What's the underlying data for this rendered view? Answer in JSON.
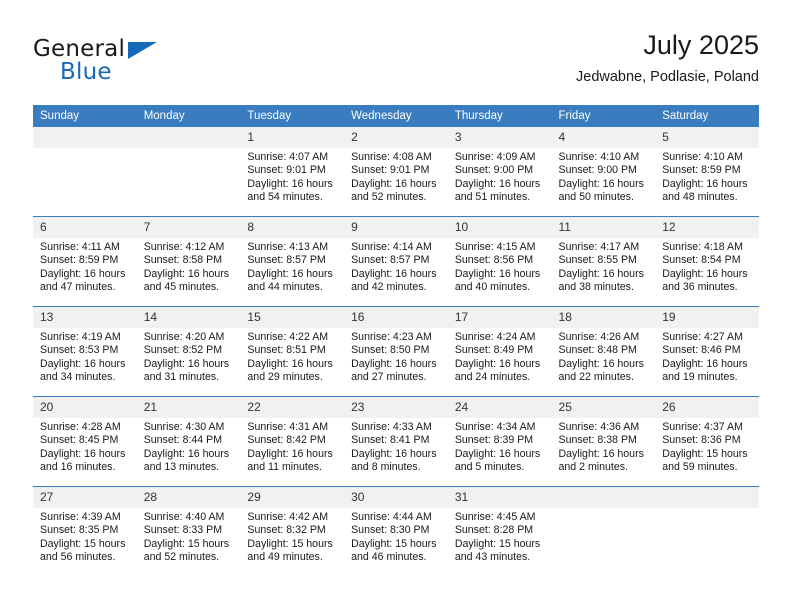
{
  "brand": {
    "line1": "General",
    "line2": "Blue",
    "triangle_color": "#1668b8"
  },
  "header": {
    "title": "July 2025",
    "subtitle": "Jedwabne, Podlasie, Poland"
  },
  "theme": {
    "header_bg": "#3a7cc0",
    "header_text": "#ffffff",
    "daynum_bg": "#f1f1f1",
    "grid_line": "#3a7cc0",
    "text": "#1a1a1a"
  },
  "weekdays": [
    "Sunday",
    "Monday",
    "Tuesday",
    "Wednesday",
    "Thursday",
    "Friday",
    "Saturday"
  ],
  "weeks": [
    [
      {
        "day": "",
        "sunrise": "",
        "sunset": "",
        "daylight_line1": "",
        "daylight_line2": ""
      },
      {
        "day": "",
        "sunrise": "",
        "sunset": "",
        "daylight_line1": "",
        "daylight_line2": ""
      },
      {
        "day": "1",
        "sunrise": "Sunrise: 4:07 AM",
        "sunset": "Sunset: 9:01 PM",
        "daylight_line1": "Daylight: 16 hours",
        "daylight_line2": "and 54 minutes."
      },
      {
        "day": "2",
        "sunrise": "Sunrise: 4:08 AM",
        "sunset": "Sunset: 9:01 PM",
        "daylight_line1": "Daylight: 16 hours",
        "daylight_line2": "and 52 minutes."
      },
      {
        "day": "3",
        "sunrise": "Sunrise: 4:09 AM",
        "sunset": "Sunset: 9:00 PM",
        "daylight_line1": "Daylight: 16 hours",
        "daylight_line2": "and 51 minutes."
      },
      {
        "day": "4",
        "sunrise": "Sunrise: 4:10 AM",
        "sunset": "Sunset: 9:00 PM",
        "daylight_line1": "Daylight: 16 hours",
        "daylight_line2": "and 50 minutes."
      },
      {
        "day": "5",
        "sunrise": "Sunrise: 4:10 AM",
        "sunset": "Sunset: 8:59 PM",
        "daylight_line1": "Daylight: 16 hours",
        "daylight_line2": "and 48 minutes."
      }
    ],
    [
      {
        "day": "6",
        "sunrise": "Sunrise: 4:11 AM",
        "sunset": "Sunset: 8:59 PM",
        "daylight_line1": "Daylight: 16 hours",
        "daylight_line2": "and 47 minutes."
      },
      {
        "day": "7",
        "sunrise": "Sunrise: 4:12 AM",
        "sunset": "Sunset: 8:58 PM",
        "daylight_line1": "Daylight: 16 hours",
        "daylight_line2": "and 45 minutes."
      },
      {
        "day": "8",
        "sunrise": "Sunrise: 4:13 AM",
        "sunset": "Sunset: 8:57 PM",
        "daylight_line1": "Daylight: 16 hours",
        "daylight_line2": "and 44 minutes."
      },
      {
        "day": "9",
        "sunrise": "Sunrise: 4:14 AM",
        "sunset": "Sunset: 8:57 PM",
        "daylight_line1": "Daylight: 16 hours",
        "daylight_line2": "and 42 minutes."
      },
      {
        "day": "10",
        "sunrise": "Sunrise: 4:15 AM",
        "sunset": "Sunset: 8:56 PM",
        "daylight_line1": "Daylight: 16 hours",
        "daylight_line2": "and 40 minutes."
      },
      {
        "day": "11",
        "sunrise": "Sunrise: 4:17 AM",
        "sunset": "Sunset: 8:55 PM",
        "daylight_line1": "Daylight: 16 hours",
        "daylight_line2": "and 38 minutes."
      },
      {
        "day": "12",
        "sunrise": "Sunrise: 4:18 AM",
        "sunset": "Sunset: 8:54 PM",
        "daylight_line1": "Daylight: 16 hours",
        "daylight_line2": "and 36 minutes."
      }
    ],
    [
      {
        "day": "13",
        "sunrise": "Sunrise: 4:19 AM",
        "sunset": "Sunset: 8:53 PM",
        "daylight_line1": "Daylight: 16 hours",
        "daylight_line2": "and 34 minutes."
      },
      {
        "day": "14",
        "sunrise": "Sunrise: 4:20 AM",
        "sunset": "Sunset: 8:52 PM",
        "daylight_line1": "Daylight: 16 hours",
        "daylight_line2": "and 31 minutes."
      },
      {
        "day": "15",
        "sunrise": "Sunrise: 4:22 AM",
        "sunset": "Sunset: 8:51 PM",
        "daylight_line1": "Daylight: 16 hours",
        "daylight_line2": "and 29 minutes."
      },
      {
        "day": "16",
        "sunrise": "Sunrise: 4:23 AM",
        "sunset": "Sunset: 8:50 PM",
        "daylight_line1": "Daylight: 16 hours",
        "daylight_line2": "and 27 minutes."
      },
      {
        "day": "17",
        "sunrise": "Sunrise: 4:24 AM",
        "sunset": "Sunset: 8:49 PM",
        "daylight_line1": "Daylight: 16 hours",
        "daylight_line2": "and 24 minutes."
      },
      {
        "day": "18",
        "sunrise": "Sunrise: 4:26 AM",
        "sunset": "Sunset: 8:48 PM",
        "daylight_line1": "Daylight: 16 hours",
        "daylight_line2": "and 22 minutes."
      },
      {
        "day": "19",
        "sunrise": "Sunrise: 4:27 AM",
        "sunset": "Sunset: 8:46 PM",
        "daylight_line1": "Daylight: 16 hours",
        "daylight_line2": "and 19 minutes."
      }
    ],
    [
      {
        "day": "20",
        "sunrise": "Sunrise: 4:28 AM",
        "sunset": "Sunset: 8:45 PM",
        "daylight_line1": "Daylight: 16 hours",
        "daylight_line2": "and 16 minutes."
      },
      {
        "day": "21",
        "sunrise": "Sunrise: 4:30 AM",
        "sunset": "Sunset: 8:44 PM",
        "daylight_line1": "Daylight: 16 hours",
        "daylight_line2": "and 13 minutes."
      },
      {
        "day": "22",
        "sunrise": "Sunrise: 4:31 AM",
        "sunset": "Sunset: 8:42 PM",
        "daylight_line1": "Daylight: 16 hours",
        "daylight_line2": "and 11 minutes."
      },
      {
        "day": "23",
        "sunrise": "Sunrise: 4:33 AM",
        "sunset": "Sunset: 8:41 PM",
        "daylight_line1": "Daylight: 16 hours",
        "daylight_line2": "and 8 minutes."
      },
      {
        "day": "24",
        "sunrise": "Sunrise: 4:34 AM",
        "sunset": "Sunset: 8:39 PM",
        "daylight_line1": "Daylight: 16 hours",
        "daylight_line2": "and 5 minutes."
      },
      {
        "day": "25",
        "sunrise": "Sunrise: 4:36 AM",
        "sunset": "Sunset: 8:38 PM",
        "daylight_line1": "Daylight: 16 hours",
        "daylight_line2": "and 2 minutes."
      },
      {
        "day": "26",
        "sunrise": "Sunrise: 4:37 AM",
        "sunset": "Sunset: 8:36 PM",
        "daylight_line1": "Daylight: 15 hours",
        "daylight_line2": "and 59 minutes."
      }
    ],
    [
      {
        "day": "27",
        "sunrise": "Sunrise: 4:39 AM",
        "sunset": "Sunset: 8:35 PM",
        "daylight_line1": "Daylight: 15 hours",
        "daylight_line2": "and 56 minutes."
      },
      {
        "day": "28",
        "sunrise": "Sunrise: 4:40 AM",
        "sunset": "Sunset: 8:33 PM",
        "daylight_line1": "Daylight: 15 hours",
        "daylight_line2": "and 52 minutes."
      },
      {
        "day": "29",
        "sunrise": "Sunrise: 4:42 AM",
        "sunset": "Sunset: 8:32 PM",
        "daylight_line1": "Daylight: 15 hours",
        "daylight_line2": "and 49 minutes."
      },
      {
        "day": "30",
        "sunrise": "Sunrise: 4:44 AM",
        "sunset": "Sunset: 8:30 PM",
        "daylight_line1": "Daylight: 15 hours",
        "daylight_line2": "and 46 minutes."
      },
      {
        "day": "31",
        "sunrise": "Sunrise: 4:45 AM",
        "sunset": "Sunset: 8:28 PM",
        "daylight_line1": "Daylight: 15 hours",
        "daylight_line2": "and 43 minutes."
      },
      {
        "day": "",
        "sunrise": "",
        "sunset": "",
        "daylight_line1": "",
        "daylight_line2": ""
      },
      {
        "day": "",
        "sunrise": "",
        "sunset": "",
        "daylight_line1": "",
        "daylight_line2": ""
      }
    ]
  ]
}
